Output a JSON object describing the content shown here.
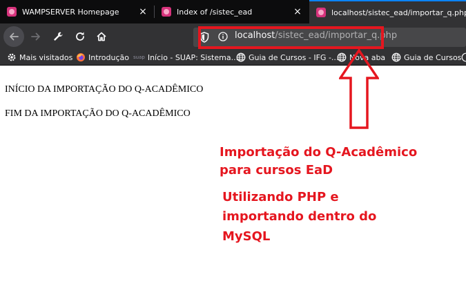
{
  "tabs": [
    {
      "title": "WAMPSERVER Homepage",
      "active": false
    },
    {
      "title": "Index of /sistec_ead",
      "active": false
    },
    {
      "title": "localhost/sistec_ead/importar_q.php",
      "active": true
    }
  ],
  "close_glyph": "×",
  "address_bar": {
    "host": "localhost",
    "path": "/sistec_ead/importar_q.php"
  },
  "bookmarks": [
    {
      "label": "Mais visitados",
      "icon": "gear-icon"
    },
    {
      "label": "Introdução",
      "icon": "firefox-icon"
    },
    {
      "label": "Início - SUAP: Sistema...",
      "icon": "suap-logo",
      "logo_text": "suap"
    },
    {
      "label": "Guia de Cursos - IFG -...",
      "icon": "globe-icon"
    },
    {
      "label": "Nova aba",
      "icon": "globe-icon"
    },
    {
      "label": "Guia de Cursos",
      "icon": "globe-icon"
    }
  ],
  "page": {
    "line1": "INÍCIO DA IMPORTAÇÃO DO Q-ACADÊMICO",
    "line2": "FIM DA IMPORTAÇÃO DO Q-ACADÊMICO"
  },
  "annotation": {
    "color": "#e5161f",
    "caption1_line1": "Importação do Q-Acadêmico",
    "caption1_line2": "para cursos EaD",
    "caption2_line1": "Utilizando PHP e",
    "caption2_line2": "importando dentro do",
    "caption2_line3": "MySQL"
  }
}
